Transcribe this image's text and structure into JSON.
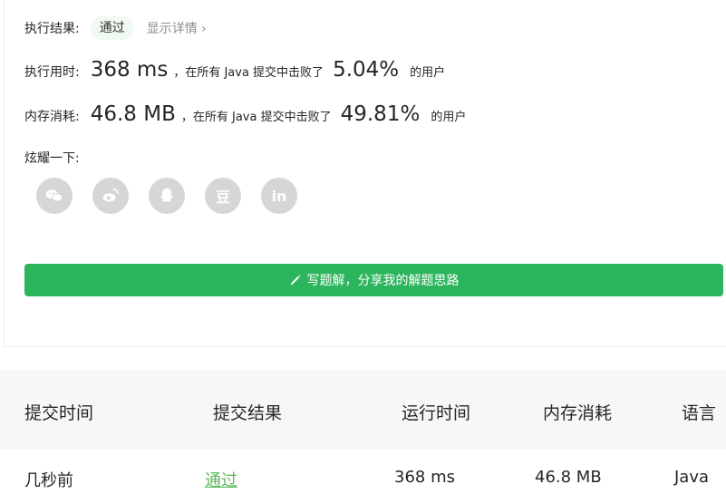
{
  "result": {
    "label": "执行结果:",
    "status": "通过",
    "detail_link": "显示详情 ›"
  },
  "runtime": {
    "label": "执行用时:",
    "value": "368 ms",
    "text": "，在所有 Java 提交中击败了",
    "percent": "5.04%",
    "suffix": "的用户"
  },
  "memory": {
    "label": "内存消耗:",
    "value": "46.8 MB",
    "text": "，在所有 Java 提交中击败了",
    "percent": "49.81%",
    "suffix": "的用户"
  },
  "share": {
    "label": "炫耀一下:",
    "icons": [
      "wechat-icon",
      "weibo-icon",
      "qq-icon",
      "douban-icon",
      "linkedin-icon"
    ],
    "douban_glyph": "豆",
    "linkedin_glyph": "in"
  },
  "write_button": {
    "label": "写题解，分享我的解题思路"
  },
  "table": {
    "headers": [
      "提交时间",
      "提交结果",
      "运行时间",
      "内存消耗",
      "语言"
    ],
    "rows": [
      [
        "几秒前",
        "通过",
        "368 ms",
        "46.8 MB",
        "Java"
      ]
    ]
  },
  "colors": {
    "accent": "#2cb55d",
    "pass_text": "#5cb85c",
    "icon_bg": "#d6d6d6"
  }
}
